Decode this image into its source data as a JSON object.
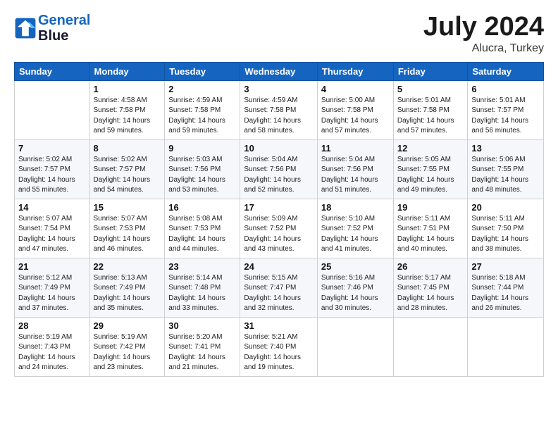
{
  "header": {
    "logo_line1": "General",
    "logo_line2": "Blue",
    "month_year": "July 2024",
    "location": "Alucra, Turkey"
  },
  "weekdays": [
    "Sunday",
    "Monday",
    "Tuesday",
    "Wednesday",
    "Thursday",
    "Friday",
    "Saturday"
  ],
  "weeks": [
    [
      {
        "day": "",
        "content": ""
      },
      {
        "day": "1",
        "content": "Sunrise: 4:58 AM\nSunset: 7:58 PM\nDaylight: 14 hours\nand 59 minutes."
      },
      {
        "day": "2",
        "content": "Sunrise: 4:59 AM\nSunset: 7:58 PM\nDaylight: 14 hours\nand 59 minutes."
      },
      {
        "day": "3",
        "content": "Sunrise: 4:59 AM\nSunset: 7:58 PM\nDaylight: 14 hours\nand 58 minutes."
      },
      {
        "day": "4",
        "content": "Sunrise: 5:00 AM\nSunset: 7:58 PM\nDaylight: 14 hours\nand 57 minutes."
      },
      {
        "day": "5",
        "content": "Sunrise: 5:01 AM\nSunset: 7:58 PM\nDaylight: 14 hours\nand 57 minutes."
      },
      {
        "day": "6",
        "content": "Sunrise: 5:01 AM\nSunset: 7:57 PM\nDaylight: 14 hours\nand 56 minutes."
      }
    ],
    [
      {
        "day": "7",
        "content": "Sunrise: 5:02 AM\nSunset: 7:57 PM\nDaylight: 14 hours\nand 55 minutes."
      },
      {
        "day": "8",
        "content": "Sunrise: 5:02 AM\nSunset: 7:57 PM\nDaylight: 14 hours\nand 54 minutes."
      },
      {
        "day": "9",
        "content": "Sunrise: 5:03 AM\nSunset: 7:56 PM\nDaylight: 14 hours\nand 53 minutes."
      },
      {
        "day": "10",
        "content": "Sunrise: 5:04 AM\nSunset: 7:56 PM\nDaylight: 14 hours\nand 52 minutes."
      },
      {
        "day": "11",
        "content": "Sunrise: 5:04 AM\nSunset: 7:56 PM\nDaylight: 14 hours\nand 51 minutes."
      },
      {
        "day": "12",
        "content": "Sunrise: 5:05 AM\nSunset: 7:55 PM\nDaylight: 14 hours\nand 49 minutes."
      },
      {
        "day": "13",
        "content": "Sunrise: 5:06 AM\nSunset: 7:55 PM\nDaylight: 14 hours\nand 48 minutes."
      }
    ],
    [
      {
        "day": "14",
        "content": "Sunrise: 5:07 AM\nSunset: 7:54 PM\nDaylight: 14 hours\nand 47 minutes."
      },
      {
        "day": "15",
        "content": "Sunrise: 5:07 AM\nSunset: 7:53 PM\nDaylight: 14 hours\nand 46 minutes."
      },
      {
        "day": "16",
        "content": "Sunrise: 5:08 AM\nSunset: 7:53 PM\nDaylight: 14 hours\nand 44 minutes."
      },
      {
        "day": "17",
        "content": "Sunrise: 5:09 AM\nSunset: 7:52 PM\nDaylight: 14 hours\nand 43 minutes."
      },
      {
        "day": "18",
        "content": "Sunrise: 5:10 AM\nSunset: 7:52 PM\nDaylight: 14 hours\nand 41 minutes."
      },
      {
        "day": "19",
        "content": "Sunrise: 5:11 AM\nSunset: 7:51 PM\nDaylight: 14 hours\nand 40 minutes."
      },
      {
        "day": "20",
        "content": "Sunrise: 5:11 AM\nSunset: 7:50 PM\nDaylight: 14 hours\nand 38 minutes."
      }
    ],
    [
      {
        "day": "21",
        "content": "Sunrise: 5:12 AM\nSunset: 7:49 PM\nDaylight: 14 hours\nand 37 minutes."
      },
      {
        "day": "22",
        "content": "Sunrise: 5:13 AM\nSunset: 7:49 PM\nDaylight: 14 hours\nand 35 minutes."
      },
      {
        "day": "23",
        "content": "Sunrise: 5:14 AM\nSunset: 7:48 PM\nDaylight: 14 hours\nand 33 minutes."
      },
      {
        "day": "24",
        "content": "Sunrise: 5:15 AM\nSunset: 7:47 PM\nDaylight: 14 hours\nand 32 minutes."
      },
      {
        "day": "25",
        "content": "Sunrise: 5:16 AM\nSunset: 7:46 PM\nDaylight: 14 hours\nand 30 minutes."
      },
      {
        "day": "26",
        "content": "Sunrise: 5:17 AM\nSunset: 7:45 PM\nDaylight: 14 hours\nand 28 minutes."
      },
      {
        "day": "27",
        "content": "Sunrise: 5:18 AM\nSunset: 7:44 PM\nDaylight: 14 hours\nand 26 minutes."
      }
    ],
    [
      {
        "day": "28",
        "content": "Sunrise: 5:19 AM\nSunset: 7:43 PM\nDaylight: 14 hours\nand 24 minutes."
      },
      {
        "day": "29",
        "content": "Sunrise: 5:19 AM\nSunset: 7:42 PM\nDaylight: 14 hours\nand 23 minutes."
      },
      {
        "day": "30",
        "content": "Sunrise: 5:20 AM\nSunset: 7:41 PM\nDaylight: 14 hours\nand 21 minutes."
      },
      {
        "day": "31",
        "content": "Sunrise: 5:21 AM\nSunset: 7:40 PM\nDaylight: 14 hours\nand 19 minutes."
      },
      {
        "day": "",
        "content": ""
      },
      {
        "day": "",
        "content": ""
      },
      {
        "day": "",
        "content": ""
      }
    ]
  ]
}
